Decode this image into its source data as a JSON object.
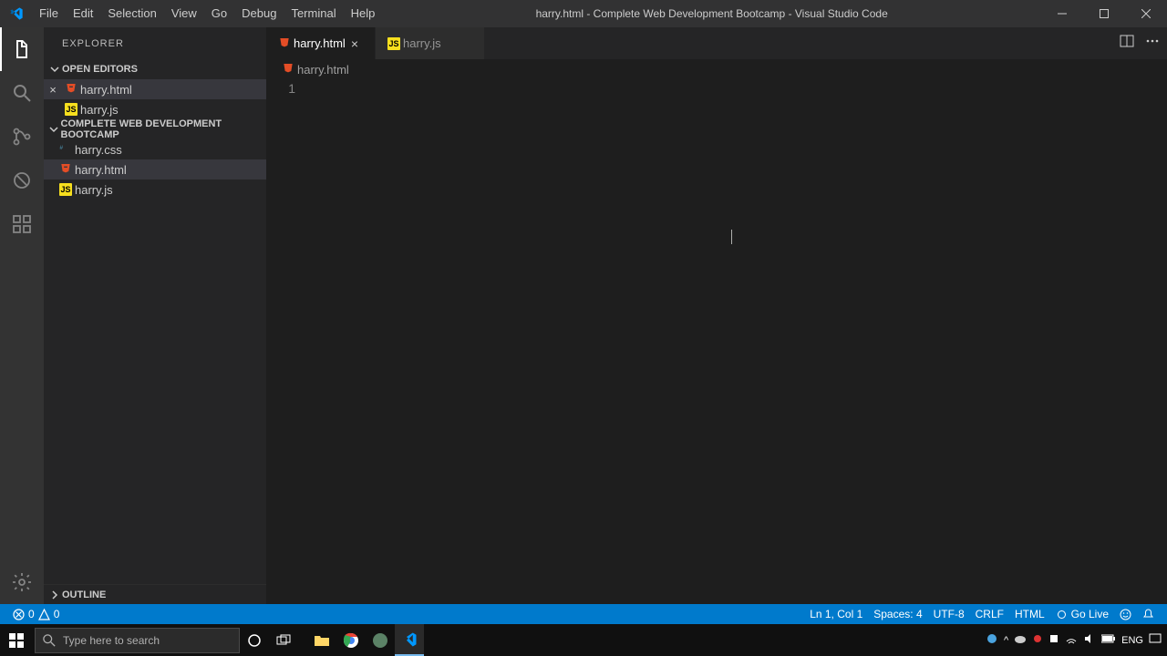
{
  "window": {
    "title": "harry.html - Complete Web Development Bootcamp - Visual Studio Code"
  },
  "menu": {
    "file": "File",
    "edit": "Edit",
    "selection": "Selection",
    "view": "View",
    "go": "Go",
    "debug": "Debug",
    "terminal": "Terminal",
    "help": "Help"
  },
  "sidebar": {
    "title": "EXPLORER",
    "open_editors_label": "OPEN EDITORS",
    "workspace_label": "COMPLETE WEB DEVELOPMENT BOOTCAMP",
    "outline_label": "OUTLINE",
    "open_editors": [
      {
        "name": "harry.html",
        "icon": "html",
        "has_close": true
      },
      {
        "name": "harry.js",
        "icon": "js",
        "has_close": false
      }
    ],
    "files": [
      {
        "name": "harry.css",
        "icon": "css",
        "selected": false
      },
      {
        "name": "harry.html",
        "icon": "html",
        "selected": true
      },
      {
        "name": "harry.js",
        "icon": "js",
        "selected": false
      }
    ]
  },
  "tabs": [
    {
      "name": "harry.html",
      "icon": "html",
      "active": true,
      "show_close": true
    },
    {
      "name": "harry.js",
      "icon": "js",
      "active": false,
      "show_close": false
    }
  ],
  "breadcrumb": {
    "file": "harry.html",
    "icon": "html"
  },
  "editor": {
    "line_number": "1"
  },
  "statusbar": {
    "errors": "0",
    "warnings": "0",
    "position": "Ln 1, Col 1",
    "spaces": "Spaces: 4",
    "encoding": "UTF-8",
    "eol": "CRLF",
    "language": "HTML",
    "golive": "Go Live"
  },
  "taskbar": {
    "search_placeholder": "Type here to search",
    "lang": "ENG"
  }
}
